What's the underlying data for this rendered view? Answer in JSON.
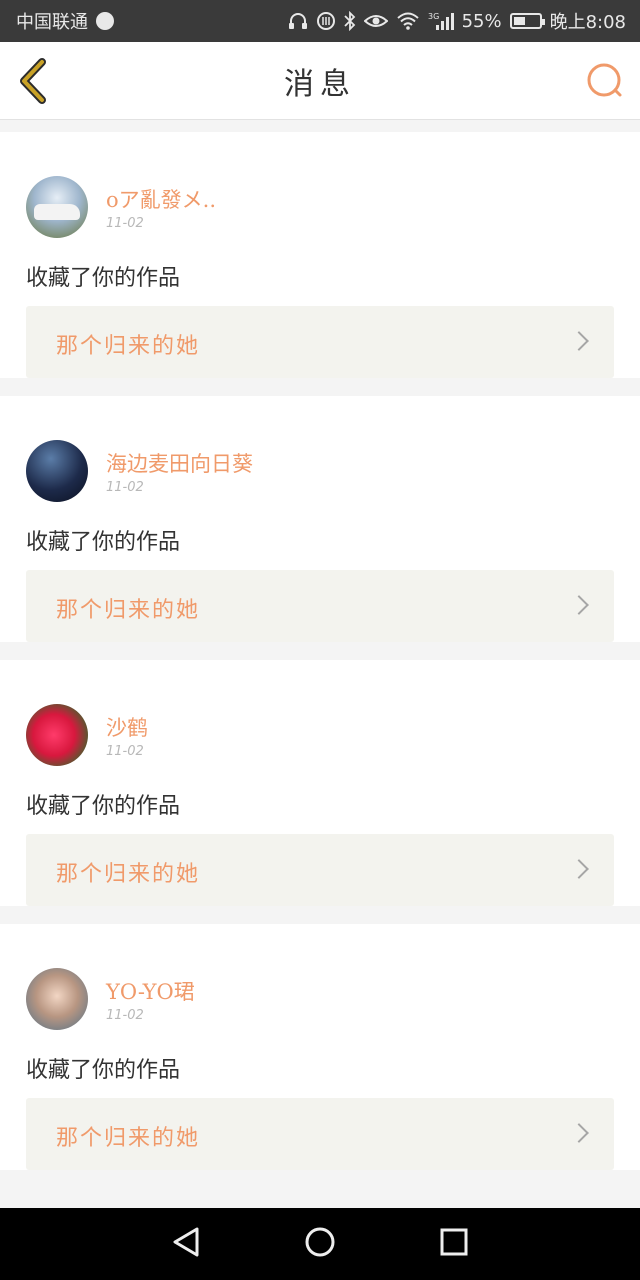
{
  "status_bar": {
    "carrier": "中国联通",
    "network": "3G",
    "battery": "55%",
    "battery_level": 0.55,
    "time": "晚上8:08"
  },
  "header": {
    "title": "消息",
    "back_icon": "back-chevron-icon",
    "search_icon": "search-icon"
  },
  "notifications": [
    {
      "user": "oア亂發メ..",
      "date": "11-02",
      "action": "收藏了你的作品",
      "work": "那个归来的她"
    },
    {
      "user": "海边麦田向日葵",
      "date": "11-02",
      "action": "收藏了你的作品",
      "work": "那个归来的她"
    },
    {
      "user": "沙鹤",
      "date": "11-02",
      "action": "收藏了你的作品",
      "work": "那个归来的她"
    },
    {
      "user": "YO-YO珺",
      "date": "11-02",
      "action": "收藏了你的作品",
      "work": "那个归来的她"
    }
  ],
  "colors": {
    "accent": "#f09a6a",
    "back_icon": "#c9a227",
    "status_bar": "#3a3a3a",
    "nav_bar": "#000000"
  }
}
